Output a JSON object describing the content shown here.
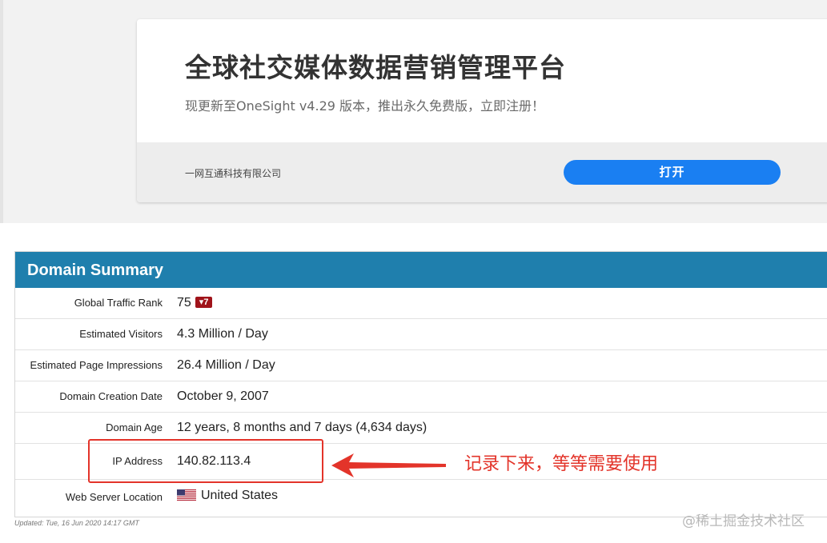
{
  "ad": {
    "title": "全球社交媒体数据营销管理平台",
    "subtitle": "现更新至OneSight v4.29 版本，推出永久免费版，立即注册！",
    "company": "一网互通科技有限公司",
    "open_label": "打开"
  },
  "summary": {
    "header": "Domain Summary",
    "rows": [
      {
        "label": "Global Traffic Rank",
        "value": "75",
        "badge": "▾7"
      },
      {
        "label": "Estimated Visitors",
        "value": "4.3 Million / Day"
      },
      {
        "label": "Estimated Page Impressions",
        "value": "26.4 Million / Day"
      },
      {
        "label": "Domain Creation Date",
        "value": "October 9, 2007"
      },
      {
        "label": "Domain Age",
        "value": "12 years, 8 months and 7 days (4,634 days)"
      },
      {
        "label": "IP Address",
        "value": "140.82.113.4"
      },
      {
        "label": "Web Server Location",
        "value": "United States",
        "flag_icon": "us-flag-icon"
      }
    ],
    "updated": "Updated: Tue, 16 Jun 2020 14:17 GMT"
  },
  "annotation": {
    "note": "记录下来，等等需要使用",
    "color": "#e3342a"
  },
  "watermark": "@稀土掘金技术社区",
  "colors": {
    "header_bg": "#1f7fad",
    "button_bg": "#1a7ff2",
    "badge_bg": "#a0131a"
  }
}
